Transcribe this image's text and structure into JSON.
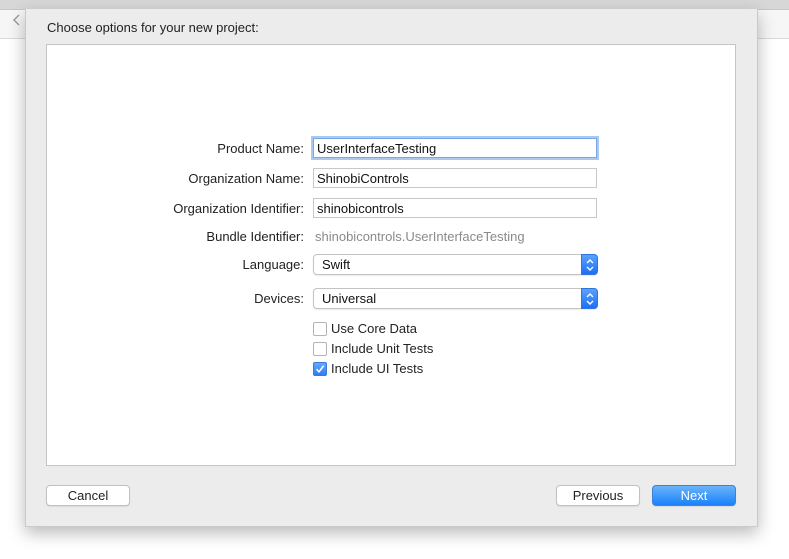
{
  "sheet": {
    "title": "Choose options for your new project:"
  },
  "form": {
    "product_name": {
      "label": "Product Name:",
      "value": "UserInterfaceTesting"
    },
    "organization_name": {
      "label": "Organization Name:",
      "value": "ShinobiControls"
    },
    "organization_identifier": {
      "label": "Organization Identifier:",
      "value": "shinobicontrols"
    },
    "bundle_identifier": {
      "label": "Bundle Identifier:",
      "value": "shinobicontrols.UserInterfaceTesting"
    },
    "language": {
      "label": "Language:",
      "value": "Swift"
    },
    "devices": {
      "label": "Devices:",
      "value": "Universal"
    },
    "checkboxes": [
      {
        "label": "Use Core Data",
        "checked": false
      },
      {
        "label": "Include Unit Tests",
        "checked": false
      },
      {
        "label": "Include UI Tests",
        "checked": true
      }
    ]
  },
  "buttons": {
    "cancel": "Cancel",
    "previous": "Previous",
    "next": "Next"
  },
  "icons": {
    "back": "chevron-left-icon",
    "popup": "up-down-arrows-icon",
    "check": "checkmark-icon"
  },
  "colors": {
    "accent": "#1a82fb",
    "focus_ring": "#a9c9f1",
    "sheet_background": "#ececec",
    "muted_text": "#8a8a8a"
  }
}
